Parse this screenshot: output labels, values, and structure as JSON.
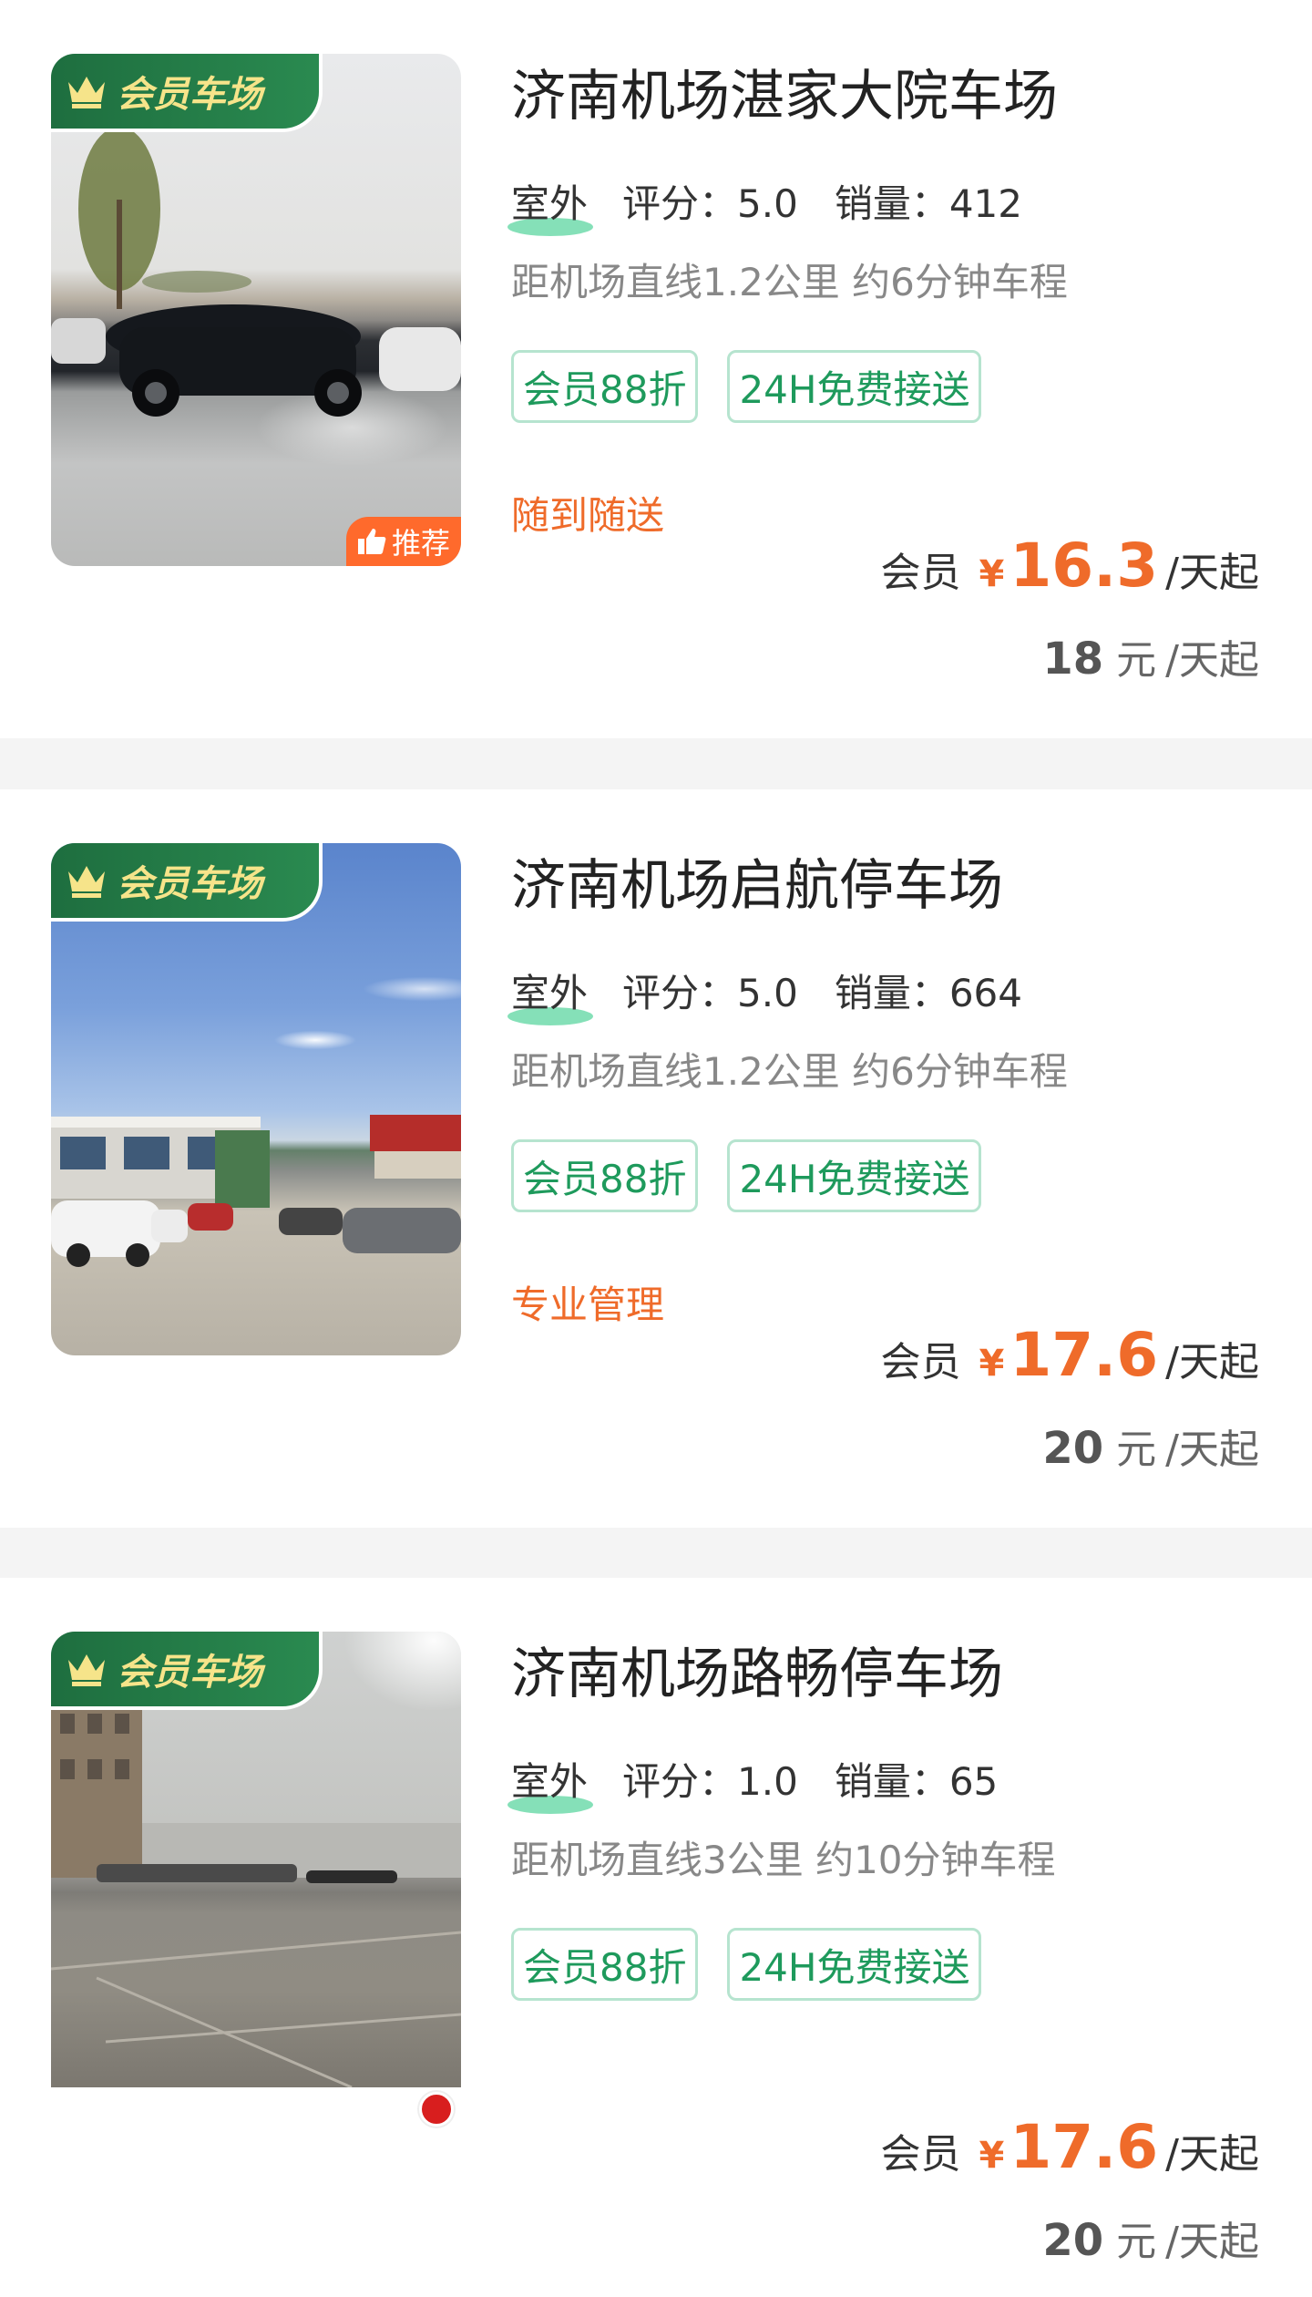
{
  "cards": [
    {
      "title": "济南机场湛家大院车场",
      "member_tag": "会员车场",
      "recommend_badge": "推荐",
      "outdoor": "室外",
      "rating": "评分：5.0",
      "sales": "销量：412",
      "distance": "距机场直线1.2公里 约6分钟车程",
      "tags": [
        "会员88折",
        "24H免费接送"
      ],
      "feature": "随到随送",
      "member_price": {
        "label": "会员",
        "currency": "¥",
        "value": "16.3",
        "unit": "/天起"
      },
      "normal_price": {
        "value": "18",
        "currency": "元",
        "unit": "/天起"
      }
    },
    {
      "title": "济南机场启航停车场",
      "member_tag": "会员车场",
      "outdoor": "室外",
      "rating": "评分：5.0",
      "sales": "销量：664",
      "distance": "距机场直线1.2公里 约6分钟车程",
      "tags": [
        "会员88折",
        "24H免费接送"
      ],
      "feature": "专业管理",
      "member_price": {
        "label": "会员",
        "currency": "¥",
        "value": "17.6",
        "unit": "/天起"
      },
      "normal_price": {
        "value": "20",
        "currency": "元",
        "unit": "/天起"
      }
    },
    {
      "title": "济南机场路畅停车场",
      "member_tag": "会员车场",
      "outdoor": "室外",
      "rating": "评分：1.0",
      "sales": "销量：65",
      "distance": "距机场直线3公里 约10分钟车程",
      "tags": [
        "会员88折",
        "24H免费接送"
      ],
      "member_price": {
        "label": "会员",
        "currency": "¥",
        "value": "17.6",
        "unit": "/天起"
      },
      "normal_price": {
        "value": "20",
        "currency": "元",
        "unit": "/天起"
      }
    }
  ],
  "colors": {
    "accent_orange": "#ef6b2a",
    "tag_green": "#1e9a5c",
    "member_tag_bg": "#1e6e3f",
    "member_tag_text": "#f6e48a",
    "separator": "#f4f4f4"
  },
  "icons": {
    "member_tag": "crown-icon",
    "recommend": "thumbs-up-icon",
    "photo_watermark": "red-circle-logo"
  }
}
